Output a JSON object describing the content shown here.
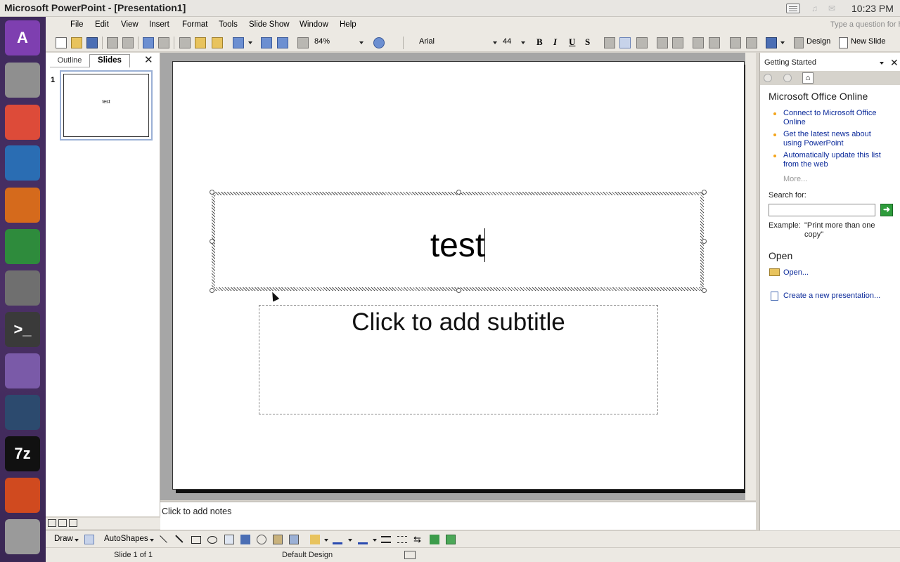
{
  "window": {
    "title": "Microsoft PowerPoint - [Presentation1]",
    "clock": "10:23 PM"
  },
  "launcher": {
    "items": [
      {
        "name": "unity-home",
        "glyph": "A",
        "color": "#7e3fb0"
      },
      {
        "name": "files",
        "glyph": "",
        "color": "#8f8f8f"
      },
      {
        "name": "chrome",
        "glyph": "",
        "color": "#dd4b39"
      },
      {
        "name": "writer",
        "glyph": "",
        "color": "#2a6db3"
      },
      {
        "name": "impress",
        "glyph": "",
        "color": "#d56a1c"
      },
      {
        "name": "calc",
        "glyph": "",
        "color": "#2e8b3c"
      },
      {
        "name": "settings",
        "glyph": "",
        "color": "#6f6f6f"
      },
      {
        "name": "terminal",
        "glyph": ">_",
        "color": "#3a3a3a"
      },
      {
        "name": "folder",
        "glyph": "",
        "color": "#7a5aa8"
      },
      {
        "name": "monitor",
        "glyph": "",
        "color": "#2c4a6e"
      },
      {
        "name": "7zip",
        "glyph": "7z",
        "color": "#111111"
      },
      {
        "name": "powerpoint",
        "glyph": "",
        "color": "#d04a1f"
      },
      {
        "name": "trash",
        "glyph": "",
        "color": "#9a9a9a"
      }
    ]
  },
  "menubar": {
    "items": [
      "File",
      "Edit",
      "View",
      "Insert",
      "Format",
      "Tools",
      "Slide Show",
      "Window",
      "Help"
    ],
    "help_placeholder": "Type a question for help"
  },
  "toolbar": {
    "zoom": "84%",
    "font_name": "Arial",
    "font_size": "44",
    "bold": "B",
    "italic": "I",
    "underline": "U",
    "shadow": "S",
    "design_label": "Design",
    "new_slide_label": "New Slide"
  },
  "leftpane": {
    "tab_outline": "Outline",
    "tab_slides": "Slides",
    "slide_number": "1",
    "thumb_text": "test"
  },
  "slide": {
    "title": "test",
    "subtitle_placeholder": "Click to add subtitle"
  },
  "notes": {
    "placeholder": "Click to add notes"
  },
  "taskpane": {
    "header": "Getting Started",
    "section_online": "Microsoft Office Online",
    "links": [
      "Connect to Microsoft Office Online",
      "Get the latest news about using PowerPoint",
      "Automatically update this list from the web"
    ],
    "more": "More...",
    "search_label": "Search for:",
    "example_label": "Example:",
    "example_text": "\"Print more than one copy\"",
    "open_header": "Open",
    "open_link": "Open...",
    "create_link": "Create a new presentation..."
  },
  "drawbar": {
    "draw_label": "Draw",
    "autoshapes_label": "AutoShapes"
  },
  "status": {
    "slide_info": "Slide 1 of 1",
    "design": "Default Design"
  }
}
